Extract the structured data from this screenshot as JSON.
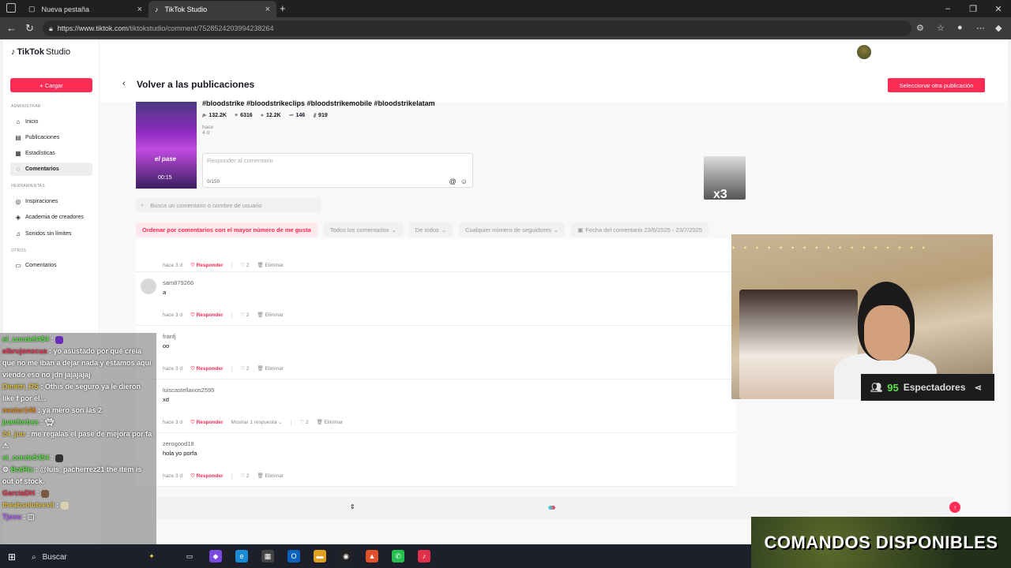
{
  "browser": {
    "tabs": [
      {
        "label": "Nueva pestaña"
      },
      {
        "label": "TikTok Studio"
      }
    ],
    "url_host": "https://www.tiktok.com",
    "url_path": "/tiktokstudio/comment/7528524203994238264"
  },
  "sidebar": {
    "logo": "TikTok",
    "logo_suffix": "Studio",
    "upload_label": "+ Cargar",
    "section_admin": "ADMINISTRAR",
    "section_tools": "HERRAMIENTAS",
    "section_other": "OTROS",
    "items": [
      {
        "label": "Inicio"
      },
      {
        "label": "Publicaciones"
      },
      {
        "label": "Estadísticas"
      },
      {
        "label": "Comentarios"
      },
      {
        "label": "Inspiraciones"
      },
      {
        "label": "Academia de creadores"
      },
      {
        "label": "Sonidos sin límites"
      },
      {
        "label": "Comentarios"
      }
    ]
  },
  "header": {
    "title": "Volver a las publicaciones",
    "select_other": "Seleccionar otra publicación"
  },
  "post": {
    "thumb_label": "el pase",
    "duration": "00:15",
    "hashtags": "#bloodstrike #bloodstrikeclips #bloodstrikemobile #bloodstrikelatam",
    "views": "132.2K",
    "likes": "6316",
    "comments": "12.2K",
    "shares": "146",
    "saves": "919",
    "time": "hace 4 d",
    "reply_placeholder": "Responder al comentario",
    "reply_count": "0/150"
  },
  "emote_text": "x3",
  "search_placeholder": "Busca un comentario o nombre de usuario",
  "filters": {
    "sort": "Ordenar por comentarios con el mayor número de me gusta",
    "all_comments": "Todos los comentarios",
    "from_all": "De todos",
    "followers": "Cualquier número de seguidores",
    "date": "Fecha del comentario  23/6/2025 - 23/7/2025"
  },
  "comment_actions": {
    "reply": "Responder",
    "delete": "Eliminar",
    "show_replies": "Mostrar 1 respuesta"
  },
  "comments": [
    {
      "user": "",
      "text": "",
      "time": "hace 3 d",
      "likes": "2"
    },
    {
      "user": "sam879266",
      "text": "a",
      "time": "hace 3 d",
      "likes": "2"
    },
    {
      "user": "franfj",
      "text": "oo",
      "time": "hace 3 d",
      "likes": "2"
    },
    {
      "user": "luiscastellanos2595",
      "text": "xd",
      "time": "hace 3 d",
      "likes": "2"
    },
    {
      "user": "zerogood18",
      "text": "hola yo porfa",
      "time": "hace 3 d",
      "likes": "2"
    }
  ],
  "stream": {
    "viewers_count": "95",
    "viewers_label": "Espectadores",
    "commands_banner": "COMANDOS DISPONIBLES"
  },
  "chat": [
    {
      "user": "el_conde5454",
      "color": "#5ee04a",
      "text": ""
    },
    {
      "user": "elbrujonocua",
      "color": "#e0304a",
      "text": "yo asustado por qué creía que no me iban a dejar nada y estamos aquí viendo eso no jdn jajajajaj"
    },
    {
      "user": "Dimitri_RS",
      "color": "#e0c040",
      "text": "Othis de seguro ya le dieron like f por el..."
    },
    {
      "user": "nestor146",
      "color": "#e08a20",
      "text": "ya mero son las 2"
    },
    {
      "user": "juanforbes",
      "color": "#5ee04a",
      "text": ""
    },
    {
      "user": "24_jun",
      "color": "#e0c040",
      "text": "me regalas el pase de mejora por fa"
    },
    {
      "user": "el_conde5454",
      "color": "#5ee04a",
      "text": ""
    },
    {
      "user": "BotRix",
      "color": "#5ee04a",
      "text": "@luis_pacherrez21 the item is out of stock."
    },
    {
      "user": "GarciaDH",
      "color": "#e0304a",
      "text": ""
    },
    {
      "user": "theabsoluteevil",
      "color": "#e0c040",
      "text": ""
    },
    {
      "user": "Tjosu",
      "color": "#b060ff",
      "text": ""
    }
  ],
  "taskbar": {
    "search": "Buscar"
  }
}
